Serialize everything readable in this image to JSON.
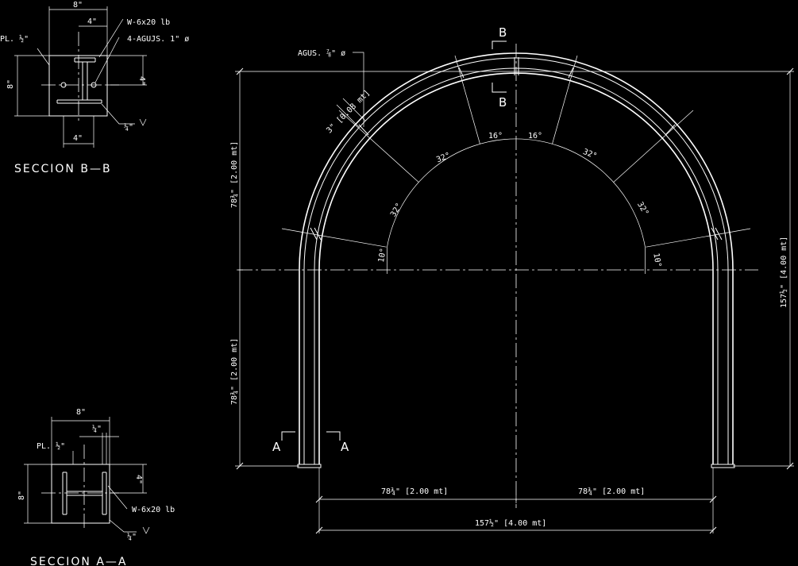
{
  "section_b": {
    "title": "SECCION B—B",
    "dim_top": "8\"",
    "dim_half": "4\"",
    "dim_left": "8\"",
    "dim_right": "4\"",
    "dim_bottom": "4\"",
    "plate": "PL. ½\"",
    "beam": "W-6x20 lb",
    "holes": "4-AGUJS. 1\" ø",
    "weld": "¼\""
  },
  "section_a": {
    "title": "SECCION A—A",
    "dim_top": "8\"",
    "dim_quarter": "¼\"",
    "dim_left": "8\"",
    "dim_right": "4\"",
    "plate": "PL. ½\"",
    "beam": "W-6x20 lb",
    "weld": "¼\""
  },
  "arch": {
    "hole_label": "AGUS. ⅞\" ø",
    "offset_label": "3\" [0.08 mt]",
    "cut_b_top": "B",
    "cut_b_bottom": "B",
    "cut_a_left": "A",
    "cut_a_right": "A",
    "angles": {
      "a16_left": "16°",
      "a16_right": "16°",
      "a32_upper_left": "32°",
      "a32_upper_right": "32°",
      "a32_lower_left": "32°",
      "a32_lower_right": "32°",
      "a10_left": "10°",
      "a10_right": "10°"
    },
    "dim_left_upper": "78¾\" [2.00 mt]",
    "dim_left_lower": "78¾\" [2.00 mt]",
    "dim_right_total": "157½\" [4.00 mt]",
    "dim_bottom_left": "78¾\" [2.00 mt]",
    "dim_bottom_right": "78¾\" [2.00 mt]",
    "dim_bottom_total": "157½\" [4.00 mt]"
  }
}
